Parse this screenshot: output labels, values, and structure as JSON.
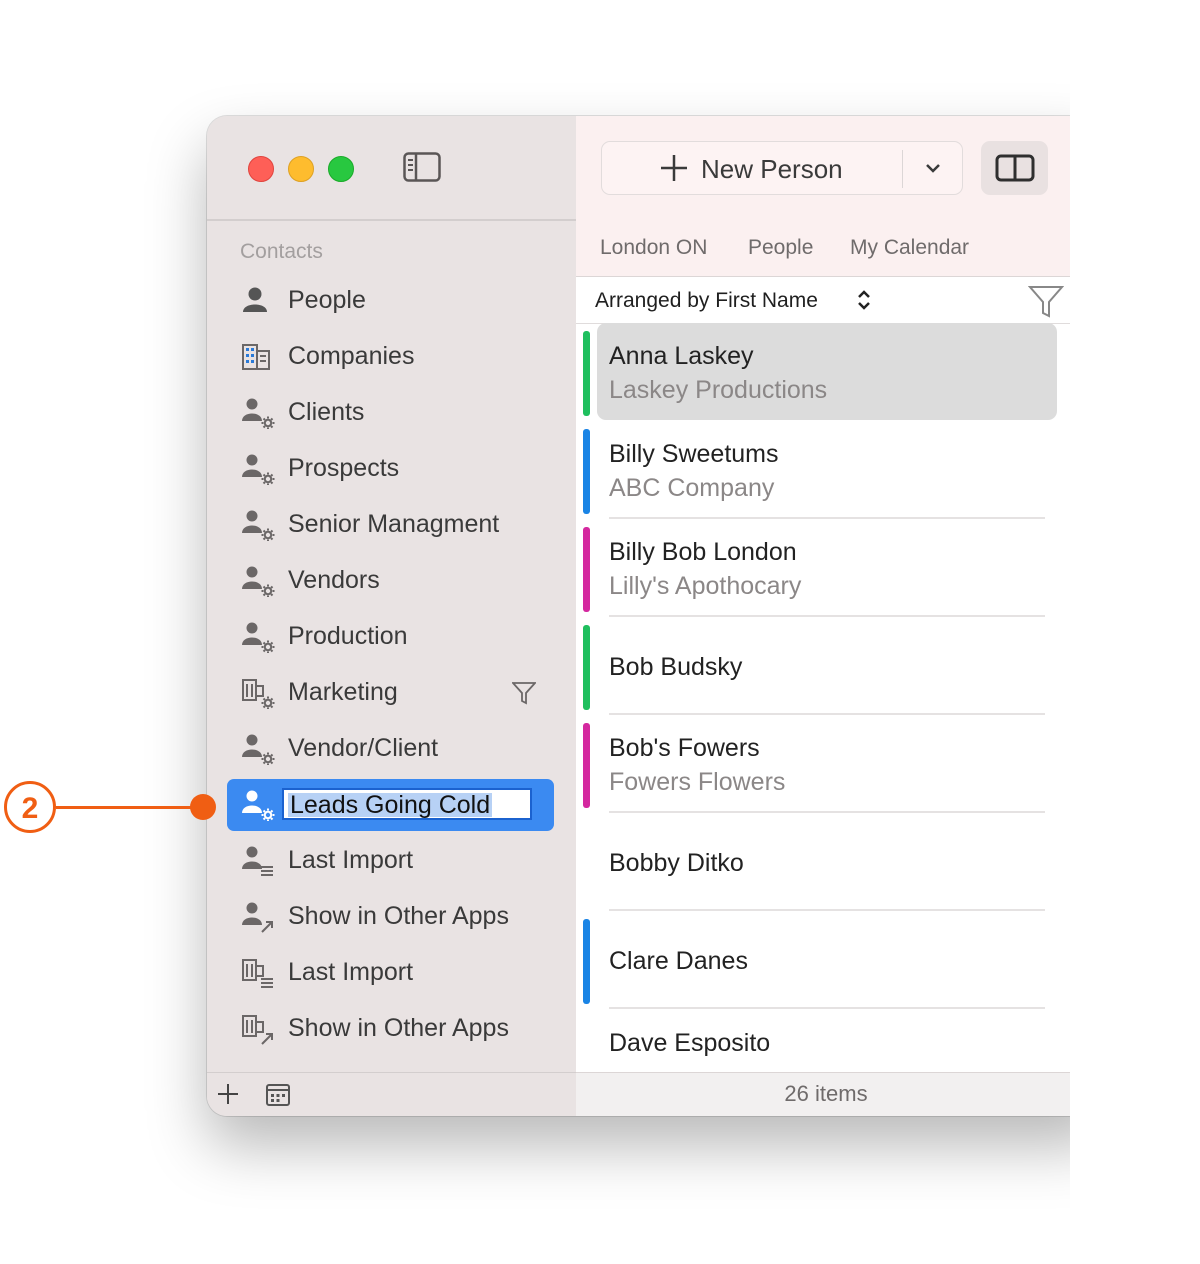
{
  "window": {
    "traffic_lights": [
      "close",
      "minimize",
      "zoom"
    ]
  },
  "sidebar": {
    "section_label": "Contacts",
    "items": [
      {
        "label": "People",
        "icon": "person-icon"
      },
      {
        "label": "Companies",
        "icon": "building-icon"
      },
      {
        "label": "Clients",
        "icon": "person-gear-icon"
      },
      {
        "label": "Prospects",
        "icon": "person-gear-icon"
      },
      {
        "label": "Senior Managment",
        "icon": "person-gear-icon"
      },
      {
        "label": "Vendors",
        "icon": "person-gear-icon"
      },
      {
        "label": "Production",
        "icon": "person-gear-icon"
      },
      {
        "label": "Marketing",
        "icon": "building-gear-icon",
        "has_filter": true
      },
      {
        "label": "Vendor/Client",
        "icon": "person-gear-icon"
      },
      {
        "label": "Leads Going Cold",
        "icon": "person-gear-icon",
        "selected": true,
        "editing": true
      },
      {
        "label": "Last Import",
        "icon": "person-list-icon"
      },
      {
        "label": "Show in Other Apps",
        "icon": "person-arrow-icon"
      },
      {
        "label": "Last Import",
        "icon": "building-list-icon"
      },
      {
        "label": "Show in Other Apps",
        "icon": "building-arrow-icon"
      }
    ],
    "footer": {
      "add_icon": "plus-icon",
      "calendar_icon": "calendar-icon"
    }
  },
  "toolbar": {
    "new_button_label": "New Person",
    "view_toggle_icon": "split-view-icon"
  },
  "breadcrumbs": [
    "London ON",
    "People",
    "My Calendar"
  ],
  "sort": {
    "label": "Arranged by First Name",
    "filter_icon": "filter-icon"
  },
  "contacts": [
    {
      "name": "Anna Laskey",
      "company": "Laskey Productions",
      "color": "#1fbf5e",
      "selected": true
    },
    {
      "name": "Billy Sweetums",
      "company": "ABC Company",
      "color": "#1a84e5"
    },
    {
      "name": "Billy Bob London",
      "company": "Lilly's Apothocary",
      "color": "#d4289f"
    },
    {
      "name": "Bob Budsky",
      "company": "",
      "color": "#1fbf5e"
    },
    {
      "name": "Bob's Fowers",
      "company": "Fowers Flowers",
      "color": "#d4289f"
    },
    {
      "name": "Bobby Ditko",
      "company": "",
      "color": ""
    },
    {
      "name": "Clare Danes",
      "company": "",
      "color": "#1a84e5"
    },
    {
      "name": "Dave Esposito",
      "company": "",
      "color": ""
    }
  ],
  "status": {
    "count": "26 items"
  },
  "callout": {
    "number": "2",
    "color": "#f05e13"
  },
  "colors": {
    "accent": "#3b8af1",
    "sidebar_bg": "#e9e3e3",
    "toolbar_bg": "#fbf0f0"
  }
}
